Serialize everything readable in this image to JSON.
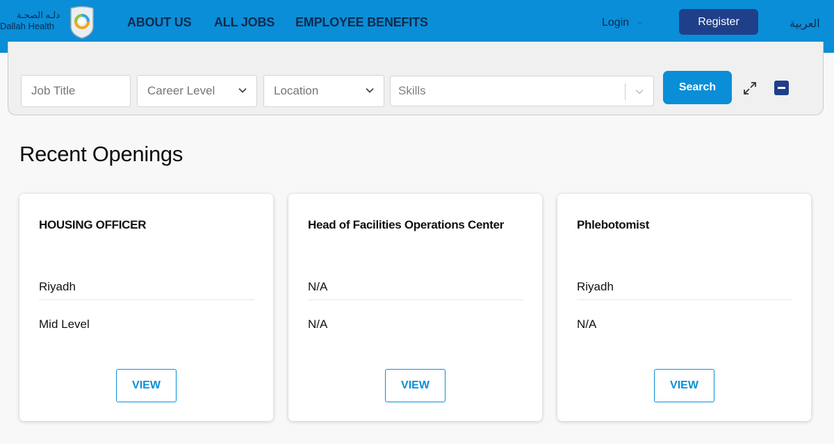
{
  "brand": {
    "name_ar": "دلـه الصحـة",
    "name_en": "Dallah Health",
    "colors": {
      "header": "#0a8ed8",
      "primary_dark": "#1f3f8a",
      "nav_text": "#102a4c"
    }
  },
  "header": {
    "nav": [
      {
        "label": "ABOUT US"
      },
      {
        "label": "ALL JOBS"
      },
      {
        "label": "EMPLOYEE BENEFITS"
      }
    ],
    "login_label": "Login",
    "register_label": "Register",
    "language_label": "العربية"
  },
  "search": {
    "job_title_placeholder": "Job Title",
    "career_level_placeholder": "Career Level",
    "location_placeholder": "Location",
    "skills_placeholder": "Skills",
    "search_button": "Search",
    "icons": {
      "expand": "expand-arrows-icon",
      "collapse": "minus-square-icon"
    }
  },
  "main": {
    "heading": "Recent Openings",
    "jobs": [
      {
        "title": "HOUSING OFFICER",
        "location": "Riyadh",
        "level": "Mid Level",
        "view_label": "VIEW"
      },
      {
        "title": "Head of Facilities Operations Center",
        "location": "N/A",
        "level": "N/A",
        "view_label": "VIEW"
      },
      {
        "title": "Phlebotomist",
        "location": "Riyadh",
        "level": "N/A",
        "view_label": "VIEW"
      }
    ]
  }
}
